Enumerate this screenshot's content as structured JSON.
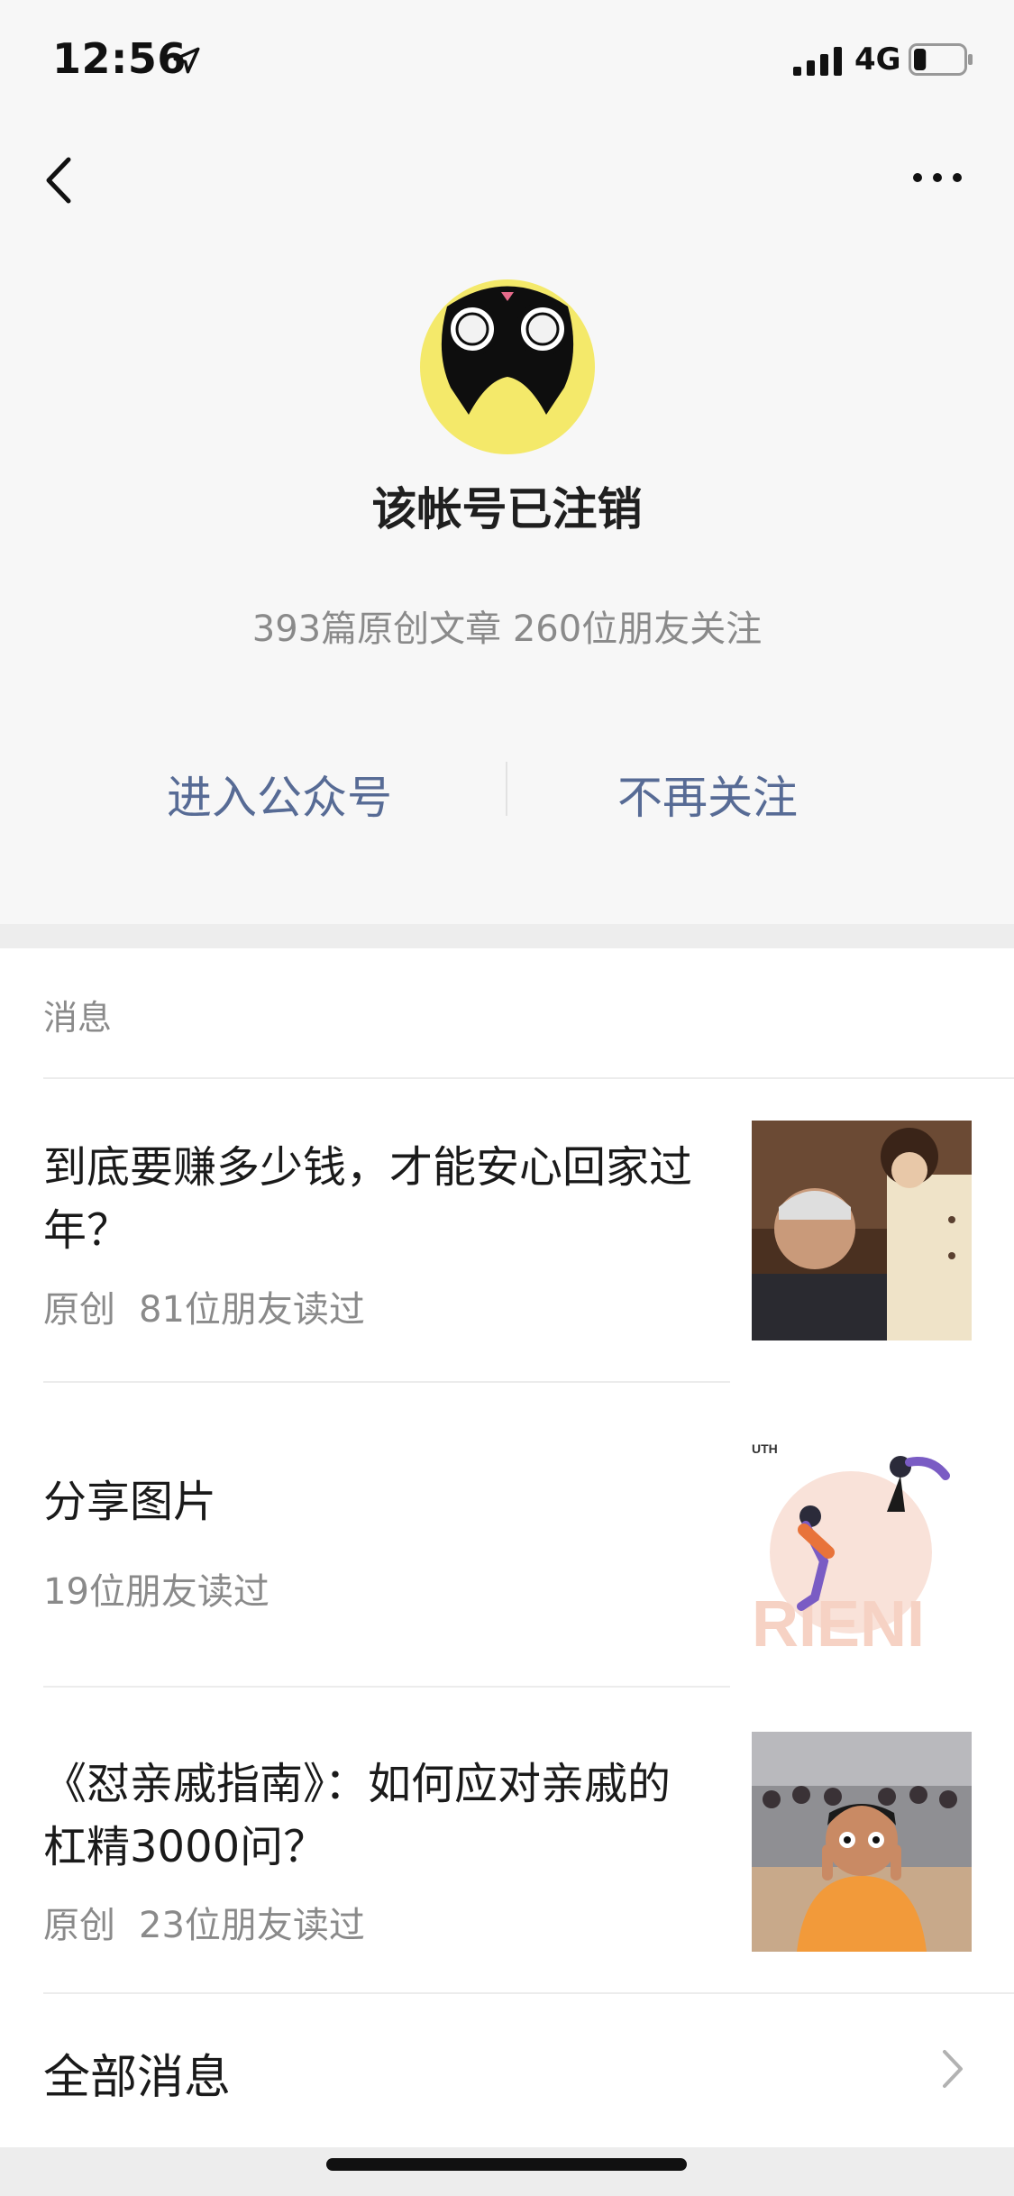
{
  "status_bar": {
    "time": "12:56",
    "network": "4G",
    "battery_level": 0.25
  },
  "profile": {
    "name": "该帐号已注销",
    "stats": "393篇原创文章  260位朋友关注",
    "enter_label": "进入公众号",
    "unfollow_label": "不再关注"
  },
  "messages": {
    "section_title": "消息",
    "items": [
      {
        "title": "到底要赚多少钱，才能安心回家过年？",
        "original": "原创",
        "reads": "81位朋友读过"
      },
      {
        "title": "分享图片",
        "original": "",
        "reads": "19位朋友读过"
      },
      {
        "title": "《怼亲戚指南》：如何应对亲戚的杠精3000问？",
        "original": "原创",
        "reads": "23位朋友读过"
      }
    ],
    "all_label": "全部消息"
  },
  "colors": {
    "accent": "#576b95",
    "avatar_yellow": "#f4e96a"
  },
  "icons": [
    "location-arrow-icon",
    "signal-icon",
    "battery-icon",
    "back-icon",
    "more-icon",
    "chevron-right-icon"
  ]
}
